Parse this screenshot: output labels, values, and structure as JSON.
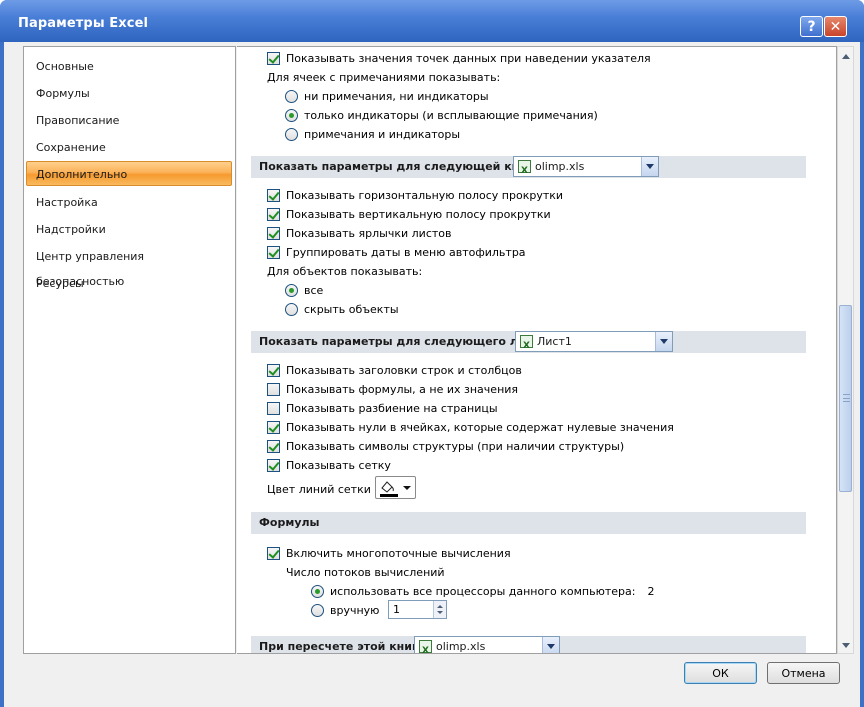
{
  "window": {
    "title": "Параметры Excel",
    "help_glyph": "?",
    "close_glyph": "✕"
  },
  "sidebar": {
    "items": [
      {
        "label": "Основные"
      },
      {
        "label": "Формулы"
      },
      {
        "label": "Правописание"
      },
      {
        "label": "Сохранение"
      },
      {
        "label": "Дополнительно",
        "selected": true
      },
      {
        "label": "Настройка"
      },
      {
        "label": "Надстройки"
      },
      {
        "label": "Центр управления безопасностью"
      },
      {
        "label": "Ресурсы"
      }
    ]
  },
  "comments": {
    "show_values_label": "Показывать значения точек данных при наведении указателя",
    "show_values_checked": true,
    "group_label": "Для ячеек с примечаниями показывать:",
    "options": [
      {
        "label": "ни примечания, ни индикаторы",
        "checked": false
      },
      {
        "label": "только индикаторы (и всплывающие примечания)",
        "checked": true
      },
      {
        "label": "примечания и индикаторы",
        "checked": false
      }
    ]
  },
  "workbook_section": {
    "title": "Показать параметры для следующей книги:",
    "dropdown_value": "olimp.xls",
    "checkboxes": [
      {
        "label": "Показывать горизонтальную полосу прокрутки",
        "checked": true
      },
      {
        "label": "Показывать вертикальную полосу прокрутки",
        "checked": true
      },
      {
        "label": "Показывать ярлычки листов",
        "checked": true
      },
      {
        "label": "Группировать даты в меню автофильтра",
        "checked": true
      }
    ],
    "objects_label": "Для объектов показывать:",
    "objects_options": [
      {
        "label": "все",
        "checked": true
      },
      {
        "label": "скрыть объекты",
        "checked": false
      }
    ]
  },
  "sheet_section": {
    "title": "Показать параметры для следующего листа:",
    "dropdown_value": "Лист1",
    "checkboxes": [
      {
        "label": "Показывать заголовки строк и столбцов",
        "checked": true
      },
      {
        "label": "Показывать формулы, а не их значения",
        "checked": false
      },
      {
        "label": "Показывать разбиение на страницы",
        "checked": false
      },
      {
        "label": "Показывать нули в ячейках, которые содержат нулевые значения",
        "checked": true
      },
      {
        "label": "Показывать символы структуры (при наличии структуры)",
        "checked": true
      },
      {
        "label": "Показывать сетку",
        "checked": true
      }
    ],
    "grid_color_label": "Цвет линий сетки"
  },
  "formulas_section": {
    "title": "Формулы",
    "multithread_label": "Включить многопоточные вычисления",
    "multithread_checked": true,
    "threads_label": "Число потоков вычислений",
    "use_all_label": "использовать все процессоры данного компьютера:",
    "use_all_value": "2",
    "use_all_checked": true,
    "manual_label": "вручную",
    "manual_checked": false,
    "manual_value": "1"
  },
  "recalc_section": {
    "title": "При пересчете этой книги:",
    "dropdown_value": "olimp.xls"
  },
  "footer": {
    "ok_label": "ОК",
    "cancel_label": "Отмена"
  },
  "colors": {
    "title_bar": "#3d71c7",
    "selected_item": "#f9b55a",
    "section_band": "#dee3ea"
  }
}
